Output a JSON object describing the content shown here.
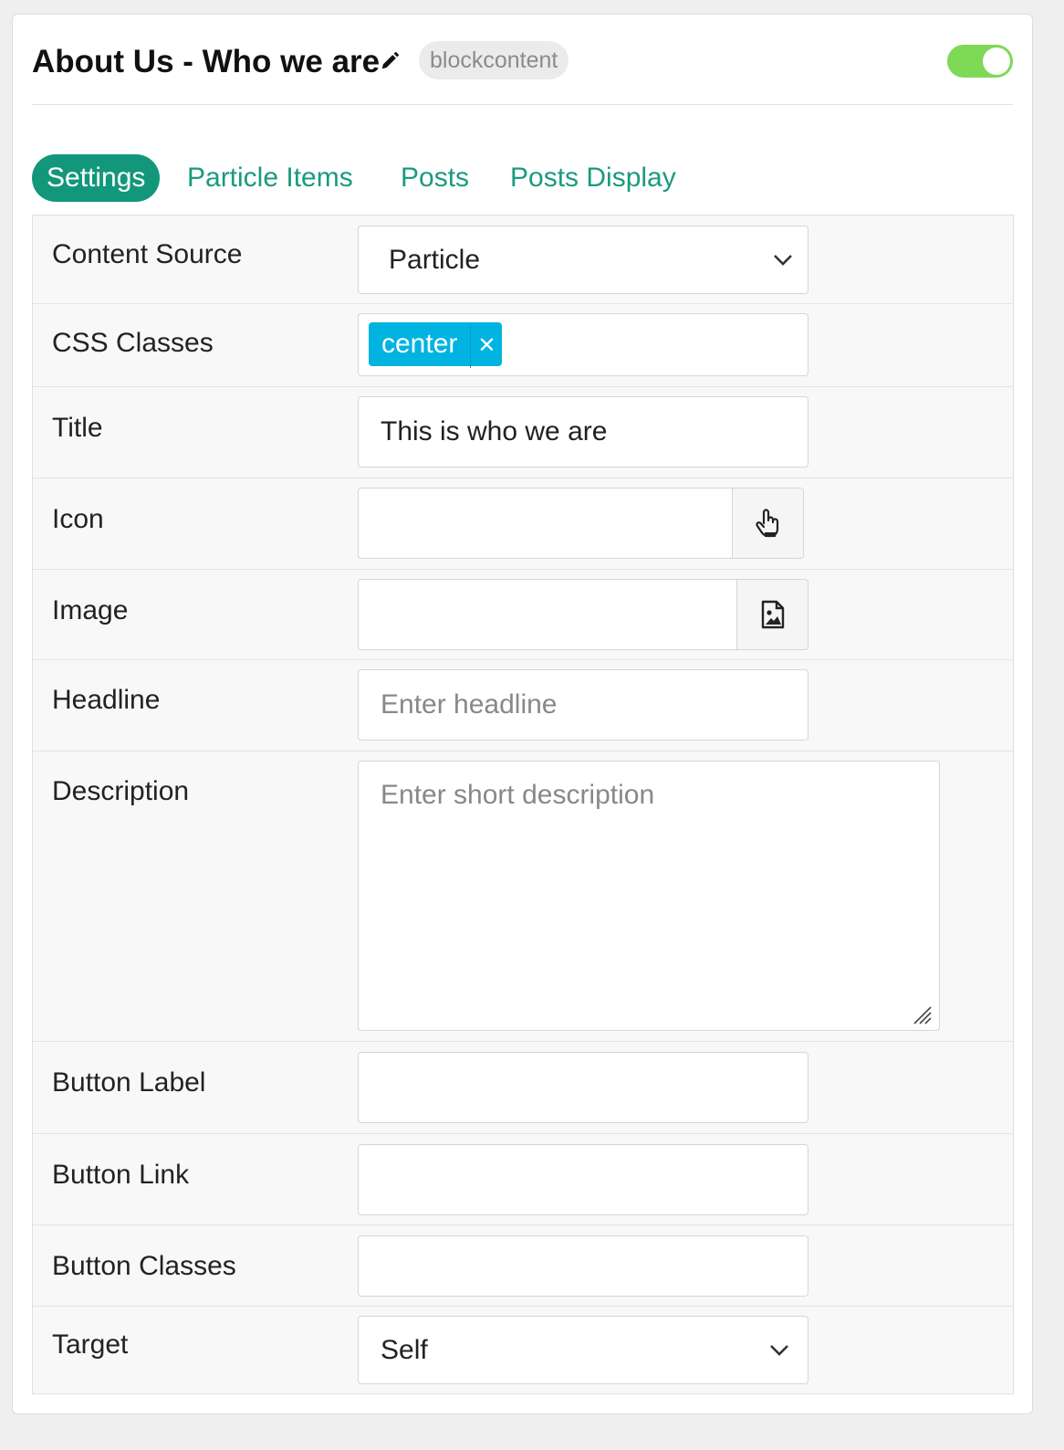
{
  "header": {
    "title": "About Us - Who we are",
    "badge": "blockcontent",
    "toggle_on": true,
    "toggle_color": "#7ed957"
  },
  "tabs": [
    {
      "label": "Settings",
      "active": true
    },
    {
      "label": "Particle Items",
      "active": false
    },
    {
      "label": "Posts",
      "active": false
    },
    {
      "label": "Posts Display",
      "active": false
    }
  ],
  "accent_color": "#13977b",
  "fields": {
    "content_source": {
      "label": "Content Source",
      "value": "Particle"
    },
    "css_classes": {
      "label": "CSS Classes",
      "tags": [
        "center"
      ],
      "tag_color": "#00b3e0"
    },
    "title": {
      "label": "Title",
      "value": "This is who we are"
    },
    "icon": {
      "label": "Icon",
      "value": "",
      "picker_icon": "hand-pointer-icon"
    },
    "image": {
      "label": "Image",
      "value": "",
      "picker_icon": "image-file-icon"
    },
    "headline": {
      "label": "Headline",
      "value": "",
      "placeholder": "Enter headline"
    },
    "description": {
      "label": "Description",
      "value": "",
      "placeholder": "Enter short description"
    },
    "button_label": {
      "label": "Button Label",
      "value": ""
    },
    "button_link": {
      "label": "Button Link",
      "value": ""
    },
    "button_classes": {
      "label": "Button Classes",
      "value": ""
    },
    "target": {
      "label": "Target",
      "value": "Self"
    }
  }
}
